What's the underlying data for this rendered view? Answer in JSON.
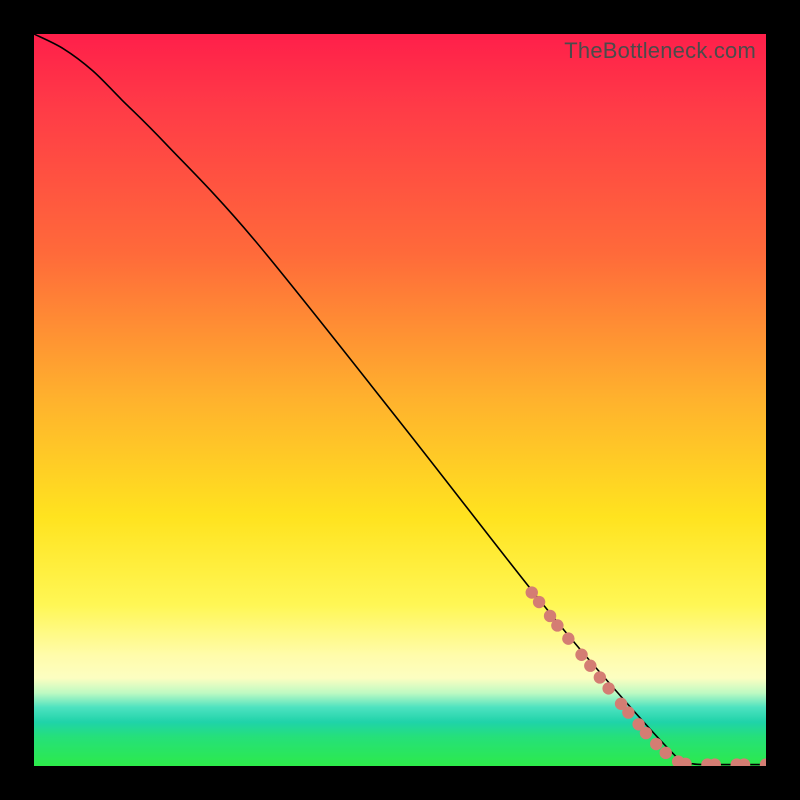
{
  "watermark": "TheBottleneck.com",
  "chart_data": {
    "type": "line",
    "title": "",
    "xlabel": "",
    "ylabel": "",
    "xlim": [
      0,
      100
    ],
    "ylim": [
      0,
      100
    ],
    "main_curve": {
      "name": "bottleneck-curve",
      "x": [
        0,
        4,
        8,
        12,
        18,
        30,
        50,
        68,
        78,
        88,
        90,
        92,
        95,
        98,
        100
      ],
      "y": [
        100,
        98,
        95,
        91,
        85,
        72,
        47,
        24,
        12,
        1,
        0.3,
        0.2,
        0.2,
        0.2,
        0.2
      ]
    },
    "markers": {
      "name": "highlight-dots",
      "color": "#d47d73",
      "points": [
        {
          "x": 68.0,
          "y": 23.7
        },
        {
          "x": 69.0,
          "y": 22.4
        },
        {
          "x": 70.5,
          "y": 20.5
        },
        {
          "x": 71.5,
          "y": 19.2
        },
        {
          "x": 73.0,
          "y": 17.4
        },
        {
          "x": 74.8,
          "y": 15.2
        },
        {
          "x": 76.0,
          "y": 13.7
        },
        {
          "x": 77.3,
          "y": 12.1
        },
        {
          "x": 78.5,
          "y": 10.6
        },
        {
          "x": 80.2,
          "y": 8.5
        },
        {
          "x": 81.2,
          "y": 7.3
        },
        {
          "x": 82.6,
          "y": 5.7
        },
        {
          "x": 83.6,
          "y": 4.5
        },
        {
          "x": 85.0,
          "y": 3.0
        },
        {
          "x": 86.3,
          "y": 1.8
        },
        {
          "x": 88.0,
          "y": 0.6
        },
        {
          "x": 89.0,
          "y": 0.3
        },
        {
          "x": 92.0,
          "y": 0.2
        },
        {
          "x": 93.0,
          "y": 0.2
        },
        {
          "x": 96.0,
          "y": 0.2
        },
        {
          "x": 97.0,
          "y": 0.2
        },
        {
          "x": 100.0,
          "y": 0.2
        }
      ]
    },
    "gradient_stops": [
      {
        "pos": 0.0,
        "color": "#ff1f4a"
      },
      {
        "pos": 0.3,
        "color": "#ff6a3a"
      },
      {
        "pos": 0.5,
        "color": "#ffb22d"
      },
      {
        "pos": 0.66,
        "color": "#ffe31f"
      },
      {
        "pos": 0.85,
        "color": "#fffcac"
      },
      {
        "pos": 0.94,
        "color": "#1fd3a9"
      },
      {
        "pos": 1.0,
        "color": "#2dea4a"
      }
    ]
  }
}
